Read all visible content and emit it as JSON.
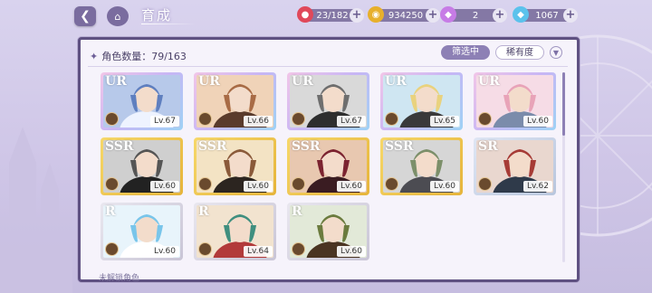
{
  "header": {
    "title": "育成",
    "back_icon": "back-arrow-icon",
    "home_icon": "castle-icon"
  },
  "resources": [
    {
      "name": "stamina",
      "icon": "candy-icon",
      "value": "23/182",
      "color": "#e0485a"
    },
    {
      "name": "gold",
      "icon": "coin-icon",
      "value": "934250",
      "color": "#e7b02c"
    },
    {
      "name": "gem",
      "icon": "pink-diamond-icon",
      "value": "2",
      "color": "#c77ce6"
    },
    {
      "name": "diamond",
      "icon": "blue-diamond-icon",
      "value": "1067",
      "color": "#5bc2ec"
    }
  ],
  "panel": {
    "count_label": "角色数量：79/163",
    "filter_label": "筛选中",
    "rarity_label": "稀有度",
    "footer_hint": "未解锁角色"
  },
  "characters": [
    {
      "rarity": "UR",
      "level": "Lv.67",
      "tier": "ur",
      "palette": [
        "#b7c9ea",
        "#5f7fbf",
        "#eef3ff"
      ]
    },
    {
      "rarity": "UR",
      "level": "Lv.66",
      "tier": "ur",
      "palette": [
        "#f0d3b8",
        "#a86b45",
        "#5a3b2c"
      ]
    },
    {
      "rarity": "UR",
      "level": "Lv.67",
      "tier": "ur",
      "palette": [
        "#d9d9d9",
        "#6e6e6e",
        "#2e2e2e"
      ]
    },
    {
      "rarity": "UR",
      "level": "Lv.65",
      "tier": "ur",
      "palette": [
        "#cfe6f2",
        "#e9d27e",
        "#3a3a3a"
      ]
    },
    {
      "rarity": "UR",
      "level": "Lv.60",
      "tier": "ur",
      "palette": [
        "#f6dce6",
        "#e8a3b8",
        "#7b8cab"
      ]
    },
    {
      "rarity": "SSR",
      "level": "Lv.60",
      "tier": "ssr",
      "palette": [
        "#cfcfcf",
        "#555555",
        "#222222"
      ]
    },
    {
      "rarity": "SSR",
      "level": "Lv.60",
      "tier": "ssr",
      "palette": [
        "#f3e3c4",
        "#8a5a3a",
        "#2c2520"
      ]
    },
    {
      "rarity": "SSR",
      "level": "Lv.60",
      "tier": "ssr",
      "palette": [
        "#e8c8b0",
        "#7b2330",
        "#3a1c22"
      ]
    },
    {
      "rarity": "SSR",
      "level": "Lv.60",
      "tier": "ssr",
      "palette": [
        "#d6d6d6",
        "#7c8f6a",
        "#4c4c52"
      ]
    },
    {
      "rarity": "SR",
      "level": "Lv.62",
      "tier": "sr",
      "palette": [
        "#e9d7cf",
        "#a63b36",
        "#2f3a4a"
      ]
    },
    {
      "rarity": "R",
      "level": "Lv.60",
      "tier": "r",
      "palette": [
        "#e8f4fb",
        "#79c5ea",
        "#ffffff"
      ]
    },
    {
      "rarity": "R",
      "level": "Lv.64",
      "tier": "r",
      "palette": [
        "#f2e3cf",
        "#3f8f7f",
        "#b23a3a"
      ]
    },
    {
      "rarity": "R",
      "level": "Lv.60",
      "tier": "r",
      "palette": [
        "#e2e9d8",
        "#6b7b3e",
        "#4a3422"
      ]
    }
  ],
  "colors": {
    "accent": "#8d80b5",
    "panel_border": "#5f5182",
    "panel_bg": "#f6f3fb"
  }
}
